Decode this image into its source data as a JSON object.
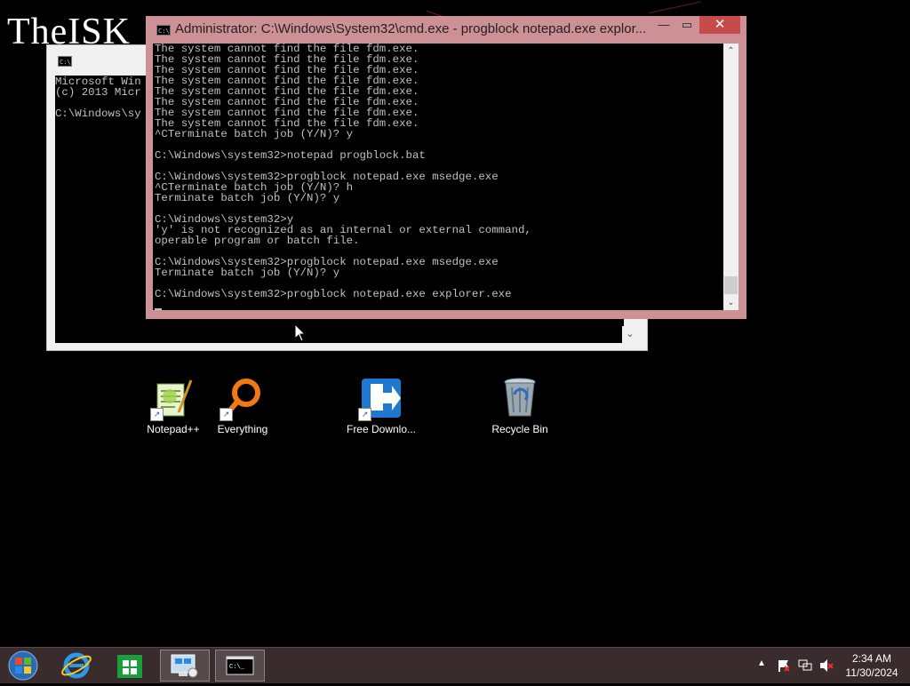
{
  "watermark": "TheISK",
  "background_window": {
    "lines": [
      "Microsoft Win",
      "(c) 2013 Micr",
      "",
      "C:\\Windows\\sy"
    ]
  },
  "foreground_window": {
    "title": "Administrator: C:\\Windows\\System32\\cmd.exe - progblock  notepad.exe explor...",
    "minimize_label": "—",
    "maximize_label": "▭",
    "close_label": "✕",
    "lines": [
      "The system cannot find the file fdm.exe.",
      "The system cannot find the file fdm.exe.",
      "The system cannot find the file fdm.exe.",
      "The system cannot find the file fdm.exe.",
      "The system cannot find the file fdm.exe.",
      "The system cannot find the file fdm.exe.",
      "The system cannot find the file fdm.exe.",
      "The system cannot find the file fdm.exe.",
      "^CTerminate batch job (Y/N)? y",
      "",
      "C:\\Windows\\system32>notepad progblock.bat",
      "",
      "C:\\Windows\\system32>progblock notepad.exe msedge.exe",
      "^CTerminate batch job (Y/N)? h",
      "Terminate batch job (Y/N)? y",
      "",
      "C:\\Windows\\system32>y",
      "'y' is not recognized as an internal or external command,",
      "operable program or batch file.",
      "",
      "C:\\Windows\\system32>progblock notepad.exe msedge.exe",
      "Terminate batch job (Y/N)? y",
      "",
      "C:\\Windows\\system32>progblock notepad.exe explorer.exe"
    ]
  },
  "desktop_icons": [
    {
      "label": "Notepad++",
      "icon": "notepad-plus-plus-icon"
    },
    {
      "label": "Everything",
      "icon": "everything-search-icon"
    },
    {
      "label": "Free Downlo...",
      "icon": "free-download-manager-icon"
    },
    {
      "label": "Recycle Bin",
      "icon": "recycle-bin-icon"
    }
  ],
  "taskbar": {
    "items": [
      "start-button",
      "internet-explorer",
      "store",
      "remote-desktop",
      "command-prompt"
    ],
    "clock_time": "2:34 AM",
    "clock_date": "11/30/2024"
  }
}
